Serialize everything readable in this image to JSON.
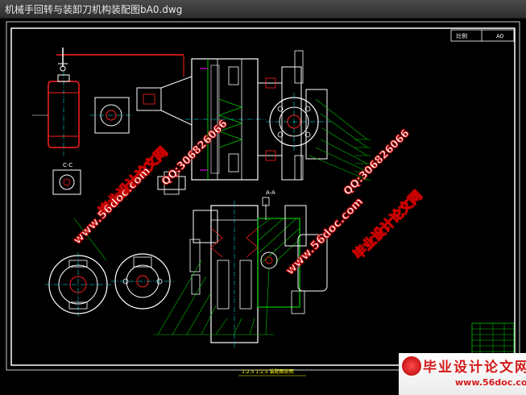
{
  "window": {
    "title": "机械手回转与装卸刀机构装配图bA0.dwg"
  },
  "drawing": {
    "title_block_top": [
      "比例",
      "A0"
    ],
    "section_labels": [
      "A-A",
      "B-B",
      "C-C"
    ],
    "bottom_note": "1:2.5 1:2.5 装配图说明"
  },
  "watermarks": {
    "site": "www.56doc.com",
    "qq": "QQ:306826066",
    "cn": "毕业设计论文网"
  },
  "logo": {
    "cn": "毕业设计论文网",
    "url": "www.56doc.com"
  },
  "colors": {
    "background": "#000000",
    "line_white": "#ffffff",
    "line_green": "#00c800",
    "line_red": "#ff2020",
    "line_cyan": "#00ffff",
    "line_yellow": "#ffff00",
    "line_magenta": "#ff00ff"
  }
}
